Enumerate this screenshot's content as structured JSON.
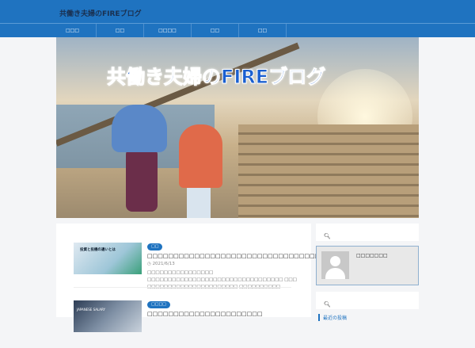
{
  "header": {
    "site_title": "共働き夫婦のFIREブログ"
  },
  "nav": {
    "items": [
      "□□□",
      "□□",
      "□□□□",
      "□□",
      "□□"
    ]
  },
  "banner": {
    "title": "共働き夫婦のFIREブログ"
  },
  "posts": [
    {
      "category": "□□",
      "title": "□□□□□□□□□□□□□□□□□□□□□□□□□□□□□□□□□□□□",
      "date": "2021/6/13",
      "excerpt": "□□□□□□□□□□□□□□□□ □□□□□□□□□□□□□□□□□□□□□□□□□□□□□□□□□ □□□ □□□□□□□□□□□□□□□□□□□□□□ □□□□□□□□□□ …",
      "thumb_text": "投資と投機の違いとは"
    },
    {
      "category": "□□□□",
      "title": "□□□□□□□□□□□□□□□□□□□□□□",
      "thumb_text": "JAPANESE SALARY"
    }
  ],
  "sidebar": {
    "search_icon": "search-icon",
    "profile_name": "□□□□□□□",
    "recent_heading": "最近の投稿"
  },
  "colors": {
    "primary": "#1f73c0"
  }
}
